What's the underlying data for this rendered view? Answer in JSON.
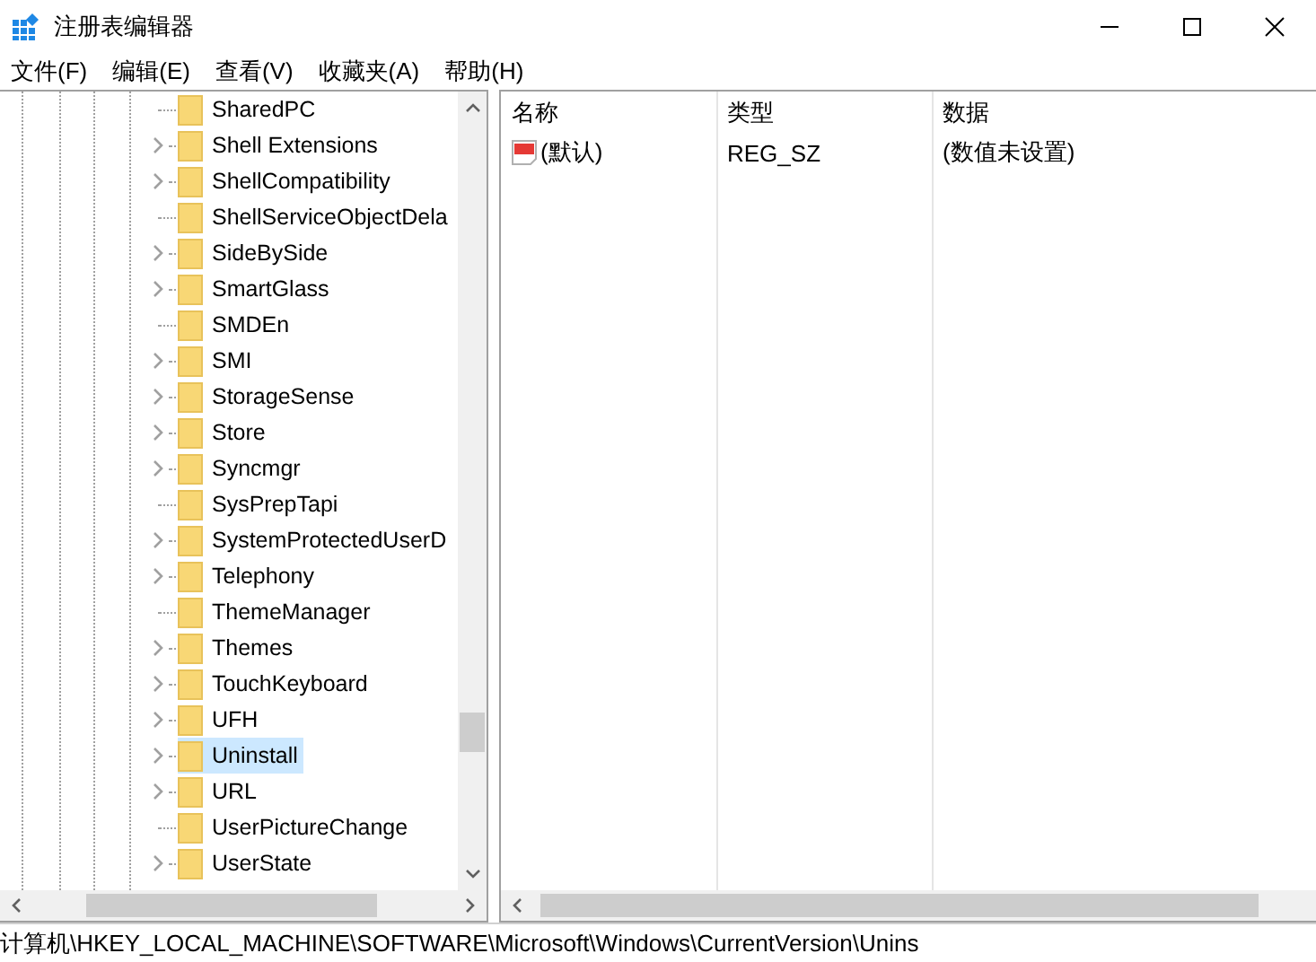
{
  "window": {
    "title": "注册表编辑器"
  },
  "menu": [
    {
      "label": "文件(F)"
    },
    {
      "label": "编辑(E)"
    },
    {
      "label": "查看(V)"
    },
    {
      "label": "收藏夹(A)"
    },
    {
      "label": "帮助(H)"
    }
  ],
  "tree": {
    "items": [
      {
        "label": "SharedPC",
        "expandable": false,
        "selected": false
      },
      {
        "label": "Shell Extensions",
        "expandable": true,
        "selected": false
      },
      {
        "label": "ShellCompatibility",
        "expandable": true,
        "selected": false
      },
      {
        "label": "ShellServiceObjectDela",
        "expandable": false,
        "selected": false
      },
      {
        "label": "SideBySide",
        "expandable": true,
        "selected": false
      },
      {
        "label": "SmartGlass",
        "expandable": true,
        "selected": false
      },
      {
        "label": "SMDEn",
        "expandable": false,
        "selected": false
      },
      {
        "label": "SMI",
        "expandable": true,
        "selected": false
      },
      {
        "label": "StorageSense",
        "expandable": true,
        "selected": false
      },
      {
        "label": "Store",
        "expandable": true,
        "selected": false
      },
      {
        "label": "Syncmgr",
        "expandable": true,
        "selected": false
      },
      {
        "label": "SysPrepTapi",
        "expandable": false,
        "selected": false
      },
      {
        "label": "SystemProtectedUserD",
        "expandable": true,
        "selected": false
      },
      {
        "label": "Telephony",
        "expandable": true,
        "selected": false
      },
      {
        "label": "ThemeManager",
        "expandable": false,
        "selected": false
      },
      {
        "label": "Themes",
        "expandable": true,
        "selected": false
      },
      {
        "label": "TouchKeyboard",
        "expandable": true,
        "selected": false
      },
      {
        "label": "UFH",
        "expandable": true,
        "selected": false
      },
      {
        "label": "Uninstall",
        "expandable": true,
        "selected": true
      },
      {
        "label": "URL",
        "expandable": true,
        "selected": false
      },
      {
        "label": "UserPictureChange",
        "expandable": false,
        "selected": false
      },
      {
        "label": "UserState",
        "expandable": true,
        "selected": false
      }
    ]
  },
  "values": {
    "columns": [
      "名称",
      "类型",
      "数据"
    ],
    "rows": [
      {
        "name": "(默认)",
        "type": "REG_SZ",
        "data": "(数值未设置)"
      }
    ]
  },
  "status_bar": "计算机\\HKEY_LOCAL_MACHINE\\SOFTWARE\\Microsoft\\Windows\\CurrentVersion\\Unins"
}
